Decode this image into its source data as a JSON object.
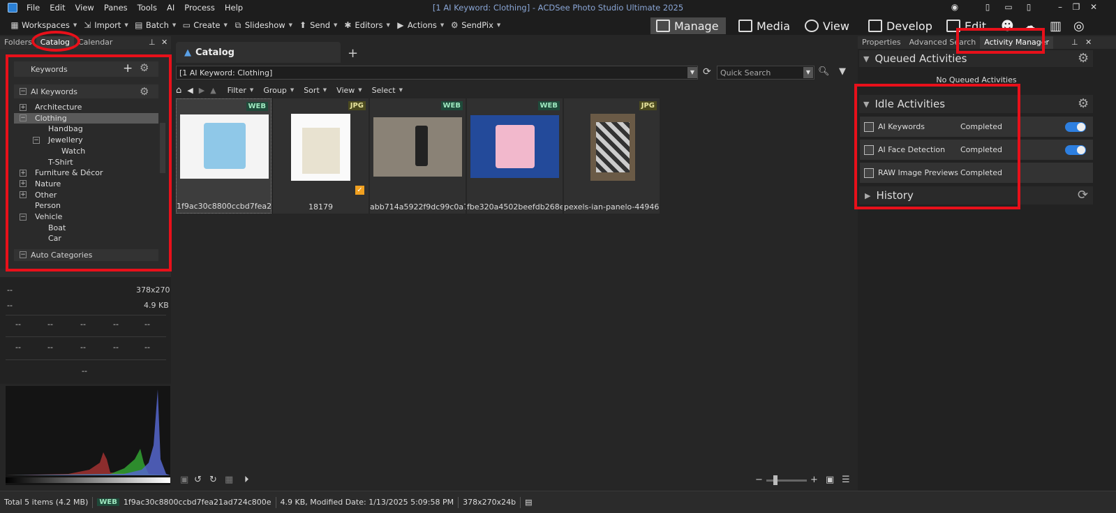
{
  "window": {
    "title": "[1 AI Keyword: Clothing] - ACDSee Photo Studio Ultimate 2025"
  },
  "menu": [
    "File",
    "Edit",
    "View",
    "Panes",
    "Tools",
    "AI",
    "Process",
    "Help"
  ],
  "toolbar": {
    "items": [
      "Workspaces",
      "Import",
      "Batch",
      "Create",
      "Slideshow",
      "Send",
      "Editors",
      "Actions",
      "SendPix"
    ],
    "modes": [
      "Manage",
      "Media",
      "View",
      "Develop",
      "Edit"
    ]
  },
  "left_panel": {
    "tabs": [
      "Folders",
      "Catalog",
      "Calendar"
    ],
    "keywords_label": "Keywords",
    "ai_keywords_label": "AI Keywords",
    "tree": [
      {
        "label": "Architecture",
        "toggle": "+"
      },
      {
        "label": "Clothing",
        "toggle": "−"
      },
      {
        "label": "Handbag",
        "toggle": ""
      },
      {
        "label": "Jewellery",
        "toggle": "−"
      },
      {
        "label": "Watch",
        "toggle": ""
      },
      {
        "label": "T-Shirt",
        "toggle": ""
      },
      {
        "label": "Furniture & Décor",
        "toggle": "+"
      },
      {
        "label": "Nature",
        "toggle": "+"
      },
      {
        "label": "Other",
        "toggle": "+"
      },
      {
        "label": "Person",
        "toggle": ""
      },
      {
        "label": "Vehicle",
        "toggle": "−"
      },
      {
        "label": "Boat",
        "toggle": ""
      },
      {
        "label": "Car",
        "toggle": ""
      }
    ],
    "auto_categories_label": "Auto Categories"
  },
  "info_panel": {
    "dimensions": "378x270",
    "size": "4.9 KB",
    "placeholder": "--"
  },
  "catalog": {
    "tab_label": "Catalog",
    "path": "[1 AI Keyword: Clothing]",
    "quick_search_placeholder": "Quick Search",
    "browse_menu": [
      "Filter",
      "Group",
      "Sort",
      "View",
      "Select"
    ],
    "thumbnails": [
      {
        "label": "1f9ac30c8800ccbd7fea21...",
        "badge": "WEB"
      },
      {
        "label": "18179",
        "badge": "JPG"
      },
      {
        "label": "abb714a5922f9dc99c0a7...",
        "badge": "WEB"
      },
      {
        "label": "fbe320a4502beefdb268e...",
        "badge": "WEB"
      },
      {
        "label": "pexels-ian-panelo-44946...",
        "badge": "JPG"
      }
    ]
  },
  "right_panel": {
    "tabs": [
      "Properties",
      "Advanced Search",
      "Activity Manager"
    ],
    "queued_label": "Queued Activities",
    "no_queued": "No Queued Activities",
    "idle_label": "Idle Activities",
    "activities": [
      {
        "name": "AI Keywords",
        "status": "Completed"
      },
      {
        "name": "AI Face Detection",
        "status": "Completed"
      },
      {
        "name": "RAW Image Previews",
        "status": "Completed"
      }
    ],
    "history_label": "History"
  },
  "status": {
    "total": "Total 5 items  (4.2 MB)",
    "badge": "WEB",
    "filename": "1f9ac30c8800ccbd7fea21ad724c800e",
    "details": "4.9 KB, Modified Date: 1/13/2025 5:09:58 PM",
    "dims": "378x270x24b"
  }
}
